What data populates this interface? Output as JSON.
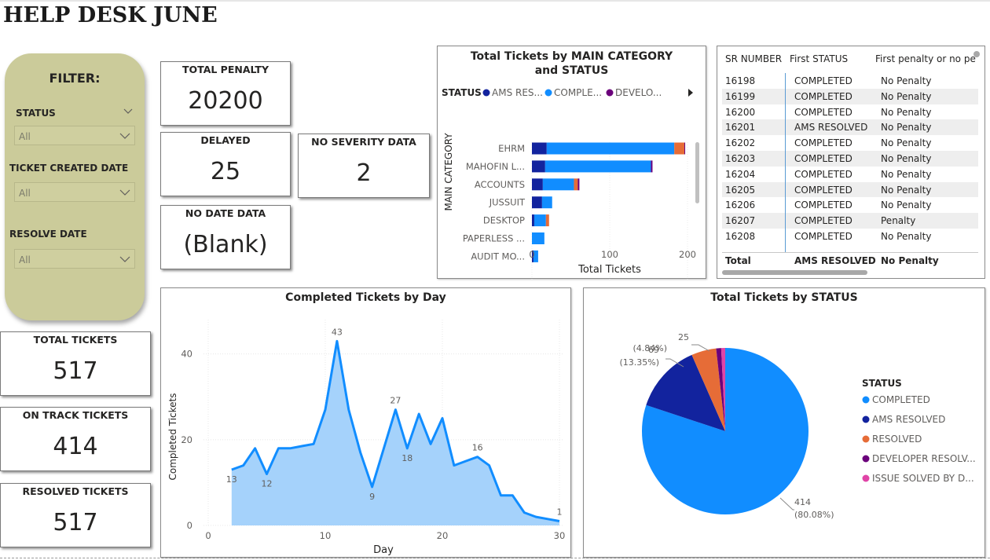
{
  "page": {
    "title": "HELP DESK JUNE"
  },
  "filter": {
    "title": "FILTER:",
    "slicers": [
      {
        "label": "STATUS",
        "value": "All"
      },
      {
        "label": "TICKET CREATED DATE",
        "value": "All"
      },
      {
        "label": "RESOLVE DATE",
        "value": "All"
      }
    ]
  },
  "cards": {
    "total_penalty": {
      "label": "TOTAL PENALTY",
      "value": "20200"
    },
    "delayed": {
      "label": "DELAYED",
      "value": "25"
    },
    "no_severity": {
      "label": "NO SEVERITY DATA",
      "value": "2"
    },
    "no_date": {
      "label": "NO DATE DATA",
      "value": "(Blank)"
    },
    "total_tickets": {
      "label": "TOTAL TICKETS",
      "value": "517"
    },
    "on_track": {
      "label": "ON TRACK TICKETS",
      "value": "414"
    },
    "resolved": {
      "label": "RESOLVED TICKETS",
      "value": "517"
    }
  },
  "colors": {
    "completed": "#118dff",
    "ams_resolved": "#12239e",
    "resolved": "#e66c37",
    "developer": "#6b007b",
    "issue_solved": "#e044a7",
    "area_fill": "#a5d2fb",
    "line": "#118dff",
    "filter_bg": "#cbcb9a"
  },
  "table": {
    "columns": [
      "SR NUMBER",
      "First STATUS",
      "First penalty or no pe"
    ],
    "rows": [
      [
        "16198",
        "COMPLETED",
        "No Penalty"
      ],
      [
        "16199",
        "COMPLETED",
        "No Penalty"
      ],
      [
        "16200",
        "COMPLETED",
        "No Penalty"
      ],
      [
        "16201",
        "AMS RESOLVED",
        "No Penalty"
      ],
      [
        "16202",
        "COMPLETED",
        "No Penalty"
      ],
      [
        "16203",
        "COMPLETED",
        "No Penalty"
      ],
      [
        "16204",
        "COMPLETED",
        "No Penalty"
      ],
      [
        "16205",
        "COMPLETED",
        "No Penalty"
      ],
      [
        "16206",
        "COMPLETED",
        "No Penalty"
      ],
      [
        "16207",
        "COMPLETED",
        "Penalty"
      ],
      [
        "16208",
        "COMPLETED",
        "No Penalty"
      ]
    ],
    "total": [
      "Total",
      "AMS RESOLVED",
      "No Penalty"
    ]
  },
  "chart_data": [
    {
      "type": "bar",
      "orientation": "horizontal",
      "stacked": true,
      "title": "Total Tickets by MAIN CATEGORY and STATUS",
      "legend_title": "STATUS",
      "legend": [
        "AMS RES...",
        "COMPLE...",
        "DEVELO..."
      ],
      "xlabel": "Total Tickets",
      "ylabel": "MAIN CATEGORY",
      "xlim": [
        0,
        200
      ],
      "xticks": [
        "0",
        "100",
        "200"
      ],
      "categories": [
        "EHRM",
        "MAHOFIN L...",
        "ACCOUNTS",
        "JUSSUIT",
        "DESKTOP",
        "PAPERLESS ...",
        "AUDIT MO..."
      ],
      "series": [
        {
          "name": "AMS RES...",
          "color": "#12239e",
          "values": [
            19,
            17,
            14,
            13,
            3,
            0,
            2
          ]
        },
        {
          "name": "COMPLE...",
          "color": "#118dff",
          "values": [
            164,
            136,
            40,
            13,
            15,
            16,
            6
          ]
        },
        {
          "name": "RESOLVED",
          "color": "#e66c37",
          "values": [
            13,
            0,
            5,
            0,
            4,
            0,
            0
          ]
        },
        {
          "name": "DEVELO...",
          "color": "#6b007b",
          "values": [
            1,
            2,
            2,
            0,
            0,
            0,
            0
          ]
        }
      ]
    },
    {
      "type": "area",
      "title": "Completed Tickets by Day",
      "xlabel": "Day",
      "ylabel": "Completed Tickets",
      "xlim": [
        0,
        30
      ],
      "ylim": [
        0,
        48
      ],
      "xticks": [
        "0",
        "10",
        "20",
        "30"
      ],
      "yticks": [
        "0",
        "20",
        "40"
      ],
      "x": [
        2,
        3,
        4,
        5,
        6,
        7,
        8,
        9,
        10,
        11,
        12,
        13,
        14,
        15,
        16,
        17,
        18,
        19,
        20,
        21,
        22,
        23,
        24,
        25,
        26,
        27,
        28,
        29,
        30
      ],
      "values": [
        13,
        14,
        18,
        12,
        18,
        18,
        18.5,
        19,
        27,
        43,
        27,
        17,
        9,
        18,
        27,
        18,
        26,
        19,
        25,
        14,
        15,
        16,
        14,
        7,
        7,
        3,
        2,
        1.5,
        1
      ],
      "data_labels": [
        {
          "x": 2,
          "y": 13,
          "text": "13"
        },
        {
          "x": 5,
          "y": 12,
          "text": "12"
        },
        {
          "x": 11,
          "y": 43,
          "text": "43"
        },
        {
          "x": 14,
          "y": 9,
          "text": "9"
        },
        {
          "x": 16,
          "y": 27,
          "text": "27"
        },
        {
          "x": 17,
          "y": 18,
          "text": "18"
        },
        {
          "x": 23,
          "y": 16,
          "text": "16"
        },
        {
          "x": 30,
          "y": 1,
          "text": "1"
        }
      ]
    },
    {
      "type": "pie",
      "title": "Total Tickets by STATUS",
      "legend_title": "STATUS",
      "labels": [
        "COMPLETED",
        "AMS RESOLVED",
        "RESOLVED",
        "DEVELOPER RESOLV...",
        "ISSUE SOLVED BY D..."
      ],
      "values": [
        414,
        69,
        25,
        5,
        4
      ],
      "colors": [
        "#118dff",
        "#12239e",
        "#e66c37",
        "#6b007b",
        "#e044a7"
      ],
      "slice_labels": [
        {
          "value": "414",
          "pct": "(80.08%)"
        },
        {
          "value": "69",
          "pct": "(13.35%)"
        },
        {
          "value": "25",
          "pct": "(4.84%)"
        }
      ]
    }
  ]
}
